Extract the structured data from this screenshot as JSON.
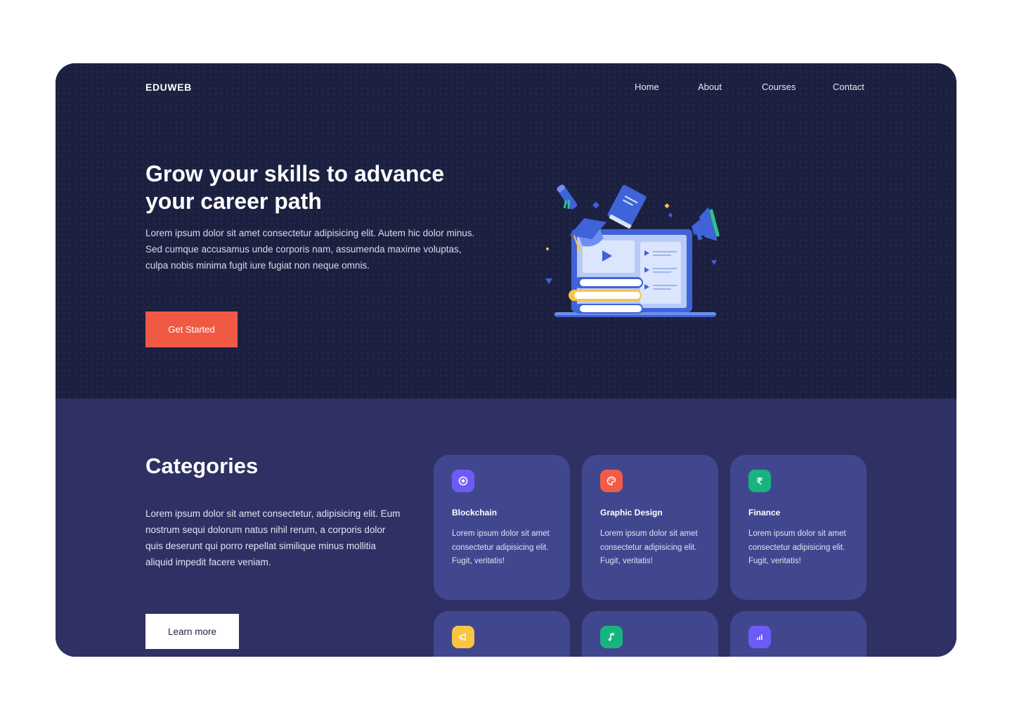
{
  "brand": "EDUWEB",
  "nav": [
    "Home",
    "About",
    "Courses",
    "Contact"
  ],
  "hero": {
    "title": "Grow your skills to advance your career path",
    "text": "Lorem ipsum dolor sit amet consectetur adipisicing elit. Autem hic dolor minus. Sed cumque accusamus unde corporis nam, assumenda maxime voluptas, culpa nobis minima fugit iure fugiat non neque omnis.",
    "cta": "Get Started"
  },
  "categories": {
    "title": "Categories",
    "text": "Lorem ipsum dolor sit amet consectetur, adipisicing elit. Eum nostrum sequi dolorum natus nihil rerum, a corporis dolor quis deserunt qui porro repellat similique minus mollitia aliquid impedit facere veniam.",
    "cta": "Learn more",
    "cards": [
      {
        "title": "Blockchain",
        "text": "Lorem ipsum dolor sit amet consectetur adipisicing elit. Fugit, veritatis!",
        "icon": "blockchain-icon",
        "color": "#6c5cf5"
      },
      {
        "title": "Graphic Design",
        "text": "Lorem ipsum dolor sit amet consectetur adipisicing elit. Fugit, veritatis!",
        "icon": "palette-icon",
        "color": "#f25c45"
      },
      {
        "title": "Finance",
        "text": "Lorem ipsum dolor sit amet consectetur adipisicing elit. Fugit, veritatis!",
        "icon": "rupee-icon",
        "color": "#18b47f"
      },
      {
        "icon": "megaphone-icon",
        "color": "#f7c543"
      },
      {
        "icon": "music-note-icon",
        "color": "#18b47f"
      },
      {
        "icon": "bar-chart-icon",
        "color": "#6c5cf5"
      }
    ]
  },
  "colors": {
    "hero_bg": "#1c2040",
    "section_bg": "#2f3164",
    "card_bg": "#41478e",
    "accent": "#f05a45"
  }
}
